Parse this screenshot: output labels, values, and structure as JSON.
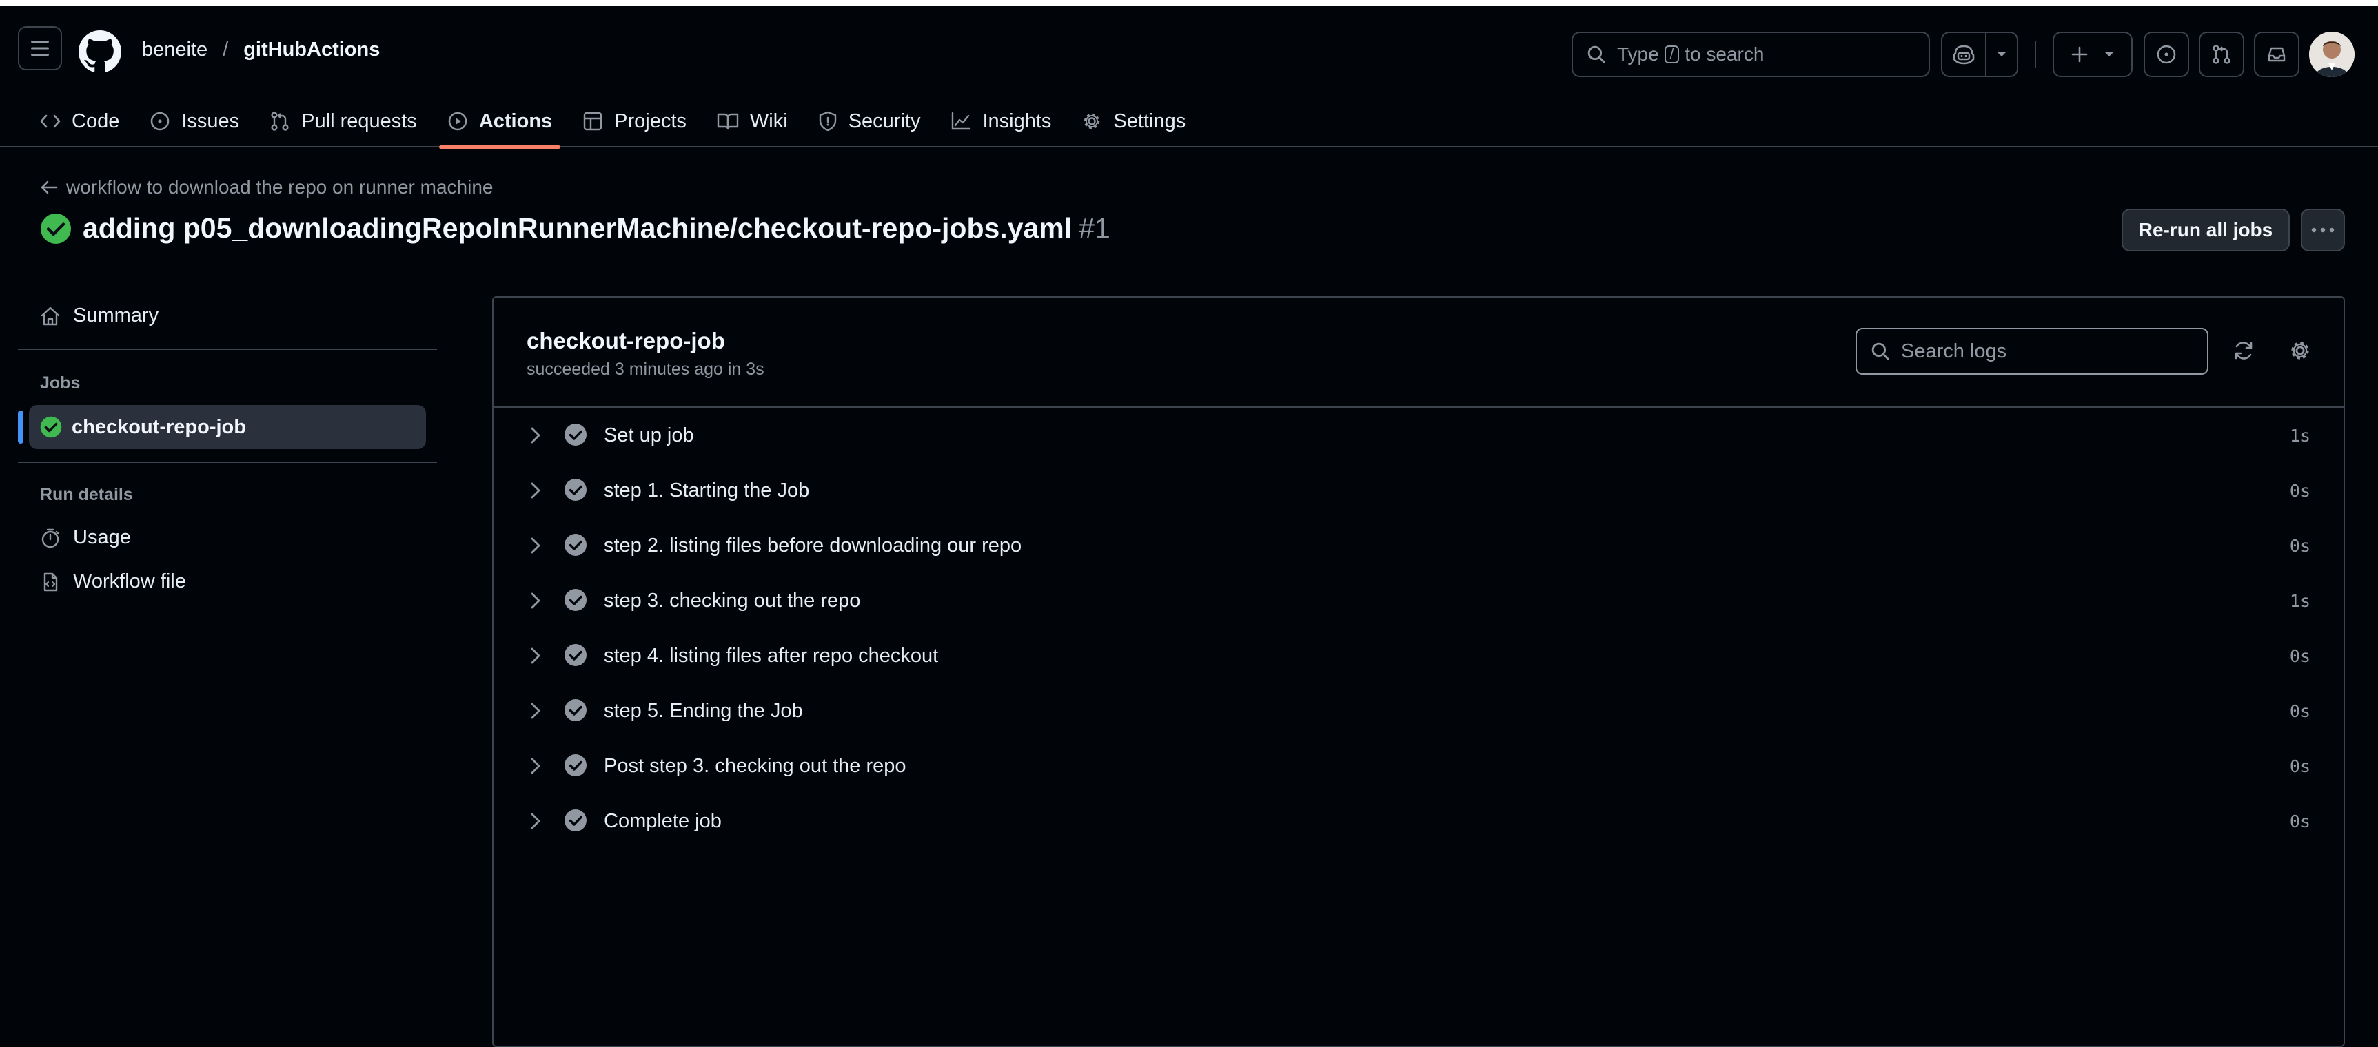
{
  "header": {
    "owner": "beneite",
    "separator": "/",
    "repo": "gitHubActions",
    "search_prefix": "Type",
    "search_key": "/",
    "search_suffix": "to search"
  },
  "nav": {
    "tabs": [
      {
        "label": "Code",
        "icon": "code-icon"
      },
      {
        "label": "Issues",
        "icon": "issue-opened-icon"
      },
      {
        "label": "Pull requests",
        "icon": "git-pull-request-icon"
      },
      {
        "label": "Actions",
        "icon": "play-icon",
        "active": true
      },
      {
        "label": "Projects",
        "icon": "table-icon"
      },
      {
        "label": "Wiki",
        "icon": "book-icon"
      },
      {
        "label": "Security",
        "icon": "shield-icon"
      },
      {
        "label": "Insights",
        "icon": "graph-icon"
      },
      {
        "label": "Settings",
        "icon": "gear-icon"
      }
    ]
  },
  "run": {
    "workflow_name": "workflow to download the repo on runner machine",
    "title": "adding p05_downloadingRepoInRunnerMachine/checkout-repo-jobs.yaml",
    "number": "#1",
    "rerun_label": "Re-run all jobs",
    "status": "success"
  },
  "sidebar": {
    "summary": "Summary",
    "jobs_heading": "Jobs",
    "job": "checkout-repo-job",
    "run_details_heading": "Run details",
    "usage": "Usage",
    "workflow_file": "Workflow file"
  },
  "job": {
    "name": "checkout-repo-job",
    "status_text": "succeeded 3 minutes ago in 3s",
    "search_placeholder": "Search logs",
    "steps": [
      {
        "label": "Set up job",
        "duration": "1s"
      },
      {
        "label": "step 1. Starting the Job",
        "duration": "0s"
      },
      {
        "label": "step 2. listing files before downloading our repo",
        "duration": "0s"
      },
      {
        "label": "step 3. checking out the repo",
        "duration": "1s"
      },
      {
        "label": "step 4. listing files after repo checkout",
        "duration": "0s"
      },
      {
        "label": "step 5. Ending the Job",
        "duration": "0s"
      },
      {
        "label": "Post step 3. checking out the repo",
        "duration": "0s"
      },
      {
        "label": "Complete job",
        "duration": "0s"
      }
    ]
  },
  "colors": {
    "background": "#010409",
    "border": "#3d444d",
    "success": "#3fb950",
    "accent_underline": "#f78166",
    "selected_bar": "#4493f8",
    "muted_text": "#9198a1"
  }
}
